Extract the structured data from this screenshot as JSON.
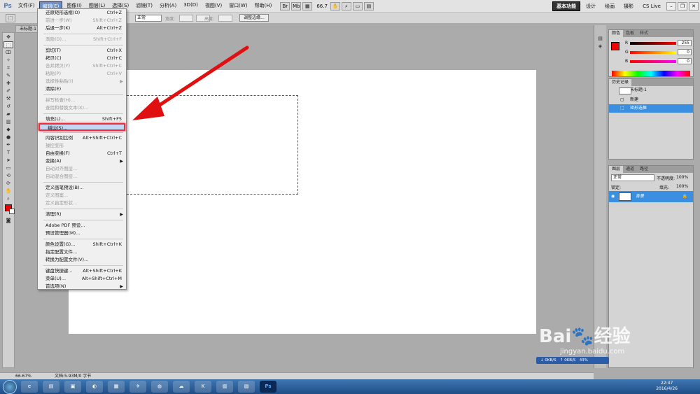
{
  "menubar": {
    "logo": "Ps",
    "items": [
      "文件(F)",
      "编辑(E)",
      "图像(I)",
      "图层(L)",
      "选择(S)",
      "滤镜(T)",
      "分析(A)",
      "3D(D)",
      "视图(V)",
      "窗口(W)",
      "帮助(H)"
    ],
    "zoom": "66.7",
    "workspaces": [
      "基本功能",
      "设计",
      "绘画",
      "摄影"
    ],
    "cs_live": "CS Live"
  },
  "options": {
    "mode": "正常",
    "width_label": "宽度:",
    "height_label": "高度:",
    "refine_button": "调整边缘..."
  },
  "document": {
    "tab": "未标题-1"
  },
  "edit_menu": {
    "items": [
      {
        "label": "还原矩形选框(O)",
        "shortcut": "Ctrl+Z",
        "disabled": false
      },
      {
        "label": "前进一步(W)",
        "shortcut": "Shift+Ctrl+Z",
        "disabled": true
      },
      {
        "label": "后退一步(K)",
        "shortcut": "Alt+Ctrl+Z",
        "disabled": false
      },
      {
        "sep": true
      },
      {
        "label": "渐隐(D)...",
        "shortcut": "Shift+Ctrl+F",
        "disabled": true
      },
      {
        "sep": true
      },
      {
        "label": "剪切(T)",
        "shortcut": "Ctrl+X",
        "disabled": false
      },
      {
        "label": "拷贝(C)",
        "shortcut": "Ctrl+C",
        "disabled": false
      },
      {
        "label": "合并拷贝(Y)",
        "shortcut": "Shift+Ctrl+C",
        "disabled": true
      },
      {
        "label": "粘贴(P)",
        "shortcut": "Ctrl+V",
        "disabled": true
      },
      {
        "label": "选择性粘贴(I)",
        "shortcut": "",
        "disabled": true,
        "submenu": true
      },
      {
        "label": "清除(E)",
        "shortcut": "",
        "disabled": false
      },
      {
        "sep": true
      },
      {
        "label": "拼写检查(H)...",
        "shortcut": "",
        "disabled": true
      },
      {
        "label": "查找和替换文本(X)...",
        "shortcut": "",
        "disabled": true
      },
      {
        "sep": true
      },
      {
        "label": "填充(L)...",
        "shortcut": "Shift+F5",
        "disabled": false
      },
      {
        "label": "描边(S)...",
        "shortcut": "",
        "disabled": false,
        "highlight": true
      },
      {
        "sep": true
      },
      {
        "label": "内容识别比例",
        "shortcut": "Alt+Shift+Ctrl+C",
        "disabled": false
      },
      {
        "label": "操控变形",
        "shortcut": "",
        "disabled": true
      },
      {
        "label": "自由变换(F)",
        "shortcut": "Ctrl+T",
        "disabled": false
      },
      {
        "label": "变换(A)",
        "shortcut": "",
        "disabled": false,
        "submenu": true
      },
      {
        "label": "自动对齐图层...",
        "shortcut": "",
        "disabled": true
      },
      {
        "label": "自动混合图层...",
        "shortcut": "",
        "disabled": true
      },
      {
        "sep": true
      },
      {
        "label": "定义画笔预设(B)...",
        "shortcut": "",
        "disabled": false
      },
      {
        "label": "定义图案...",
        "shortcut": "",
        "disabled": true
      },
      {
        "label": "定义自定形状...",
        "shortcut": "",
        "disabled": true
      },
      {
        "sep": true
      },
      {
        "label": "清理(R)",
        "shortcut": "",
        "disabled": false,
        "submenu": true
      },
      {
        "sep": true
      },
      {
        "label": "Adobe PDF 预设...",
        "shortcut": "",
        "disabled": false
      },
      {
        "label": "预设管理器(M)...",
        "shortcut": "",
        "disabled": false
      },
      {
        "sep": true
      },
      {
        "label": "颜色设置(G)...",
        "shortcut": "Shift+Ctrl+K",
        "disabled": false
      },
      {
        "label": "指定配置文件...",
        "shortcut": "",
        "disabled": false
      },
      {
        "label": "转换为配置文件(V)...",
        "shortcut": "",
        "disabled": false
      },
      {
        "sep": true
      },
      {
        "label": "键盘快捷键...",
        "shortcut": "Alt+Shift+Ctrl+K",
        "disabled": false
      },
      {
        "label": "菜单(U)...",
        "shortcut": "Alt+Shift+Ctrl+M",
        "disabled": false
      },
      {
        "label": "首选项(N)",
        "shortcut": "",
        "disabled": false,
        "submenu": true
      }
    ]
  },
  "color_panel": {
    "tabs": [
      "颜色",
      "色板",
      "样式"
    ],
    "channels": [
      {
        "label": "R",
        "value": "255"
      },
      {
        "label": "G",
        "value": "0"
      },
      {
        "label": "B",
        "value": "0"
      }
    ],
    "fg_color": "#ff0000"
  },
  "history_panel": {
    "tabs": [
      "历史记录"
    ],
    "snapshot": "未标题-1",
    "items": [
      {
        "label": "新建",
        "selected": false
      },
      {
        "label": "矩形选框",
        "selected": true
      }
    ]
  },
  "layers_panel": {
    "tabs": [
      "图层",
      "通道",
      "路径"
    ],
    "blend": "正常",
    "opacity_label": "不透明度:",
    "opacity": "100%",
    "lock_label": "锁定:",
    "fill_label": "填充:",
    "fill": "100%",
    "layers": [
      {
        "name": "背景",
        "selected": true
      }
    ]
  },
  "status": {
    "zoom": "66.67%",
    "doc": "文档:5.93M/0 字节"
  },
  "netspeed": {
    "down": "0KB/S",
    "up": "0KB/S",
    "pct": "43%"
  },
  "taskbar": {
    "time": "22:47",
    "date": "2016/4/26"
  },
  "watermark": {
    "brand": "Bai",
    "brand2": "经验",
    "url": "jingyan.baidu.com"
  },
  "colors": {
    "highlight": "#e83040",
    "selection": "#3b8fe0",
    "arrow": "#e01010"
  }
}
